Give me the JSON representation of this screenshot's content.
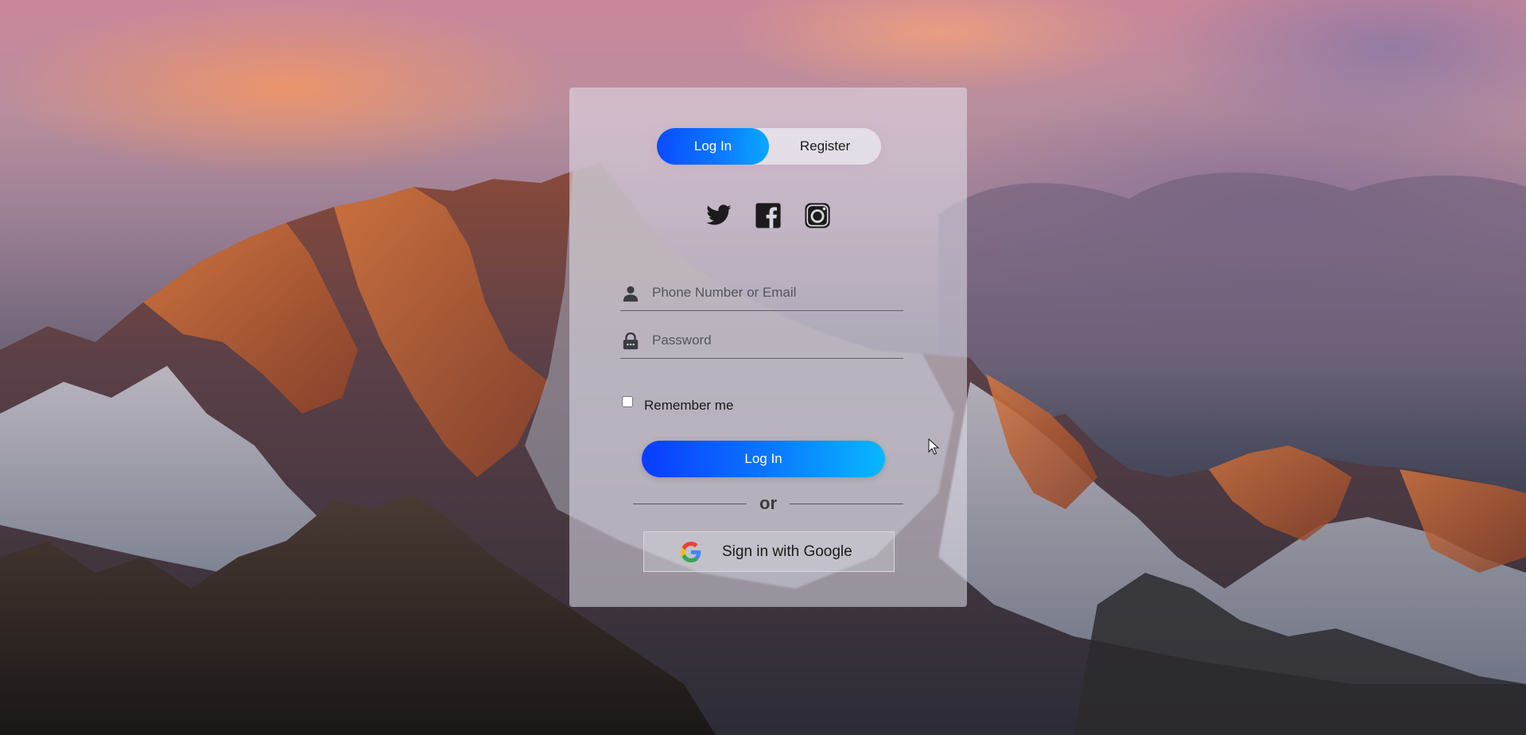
{
  "tabs": {
    "login_label": "Log In",
    "register_label": "Register",
    "active": "login"
  },
  "social": {
    "icons": [
      "twitter-icon",
      "facebook-icon",
      "instagram-icon"
    ]
  },
  "form": {
    "username": {
      "placeholder": "Phone Number or Email",
      "value": "",
      "icon": "user-icon"
    },
    "password": {
      "placeholder": "Password",
      "value": "",
      "icon": "lock-icon"
    },
    "remember_label": "Remember me",
    "remember_checked": false,
    "submit_label": "Log In",
    "or_text": "or",
    "google_label": "Sign in with Google"
  },
  "colors": {
    "accent_start": "#0a3cff",
    "accent_end": "#07b8ff",
    "card_bg": "rgba(228,226,236,0.55)"
  }
}
